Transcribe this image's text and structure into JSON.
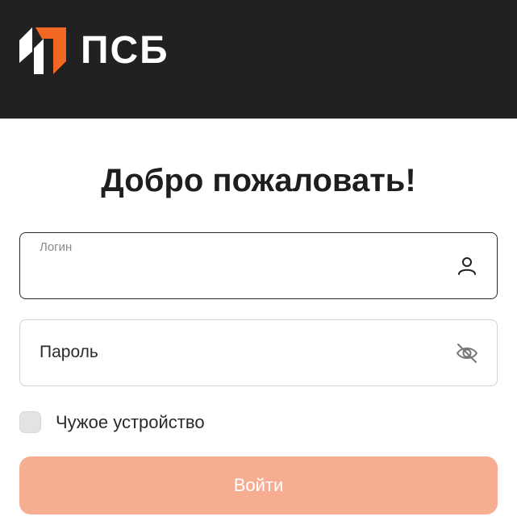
{
  "header": {
    "logo_text": "ПСБ",
    "logo_icon": "psb-logo-mark-icon",
    "background": "#212121",
    "logo_orange": "#f26722"
  },
  "title": "Добро пожаловать!",
  "login": {
    "label": "Логин",
    "value": "",
    "icon": "user-icon"
  },
  "password": {
    "placeholder": "Пароль",
    "value": "",
    "icon": "eye-off-icon"
  },
  "foreign_device": {
    "label": "Чужое устройство",
    "checked": false
  },
  "submit": {
    "label": "Войти",
    "background": "#f6ad91"
  }
}
